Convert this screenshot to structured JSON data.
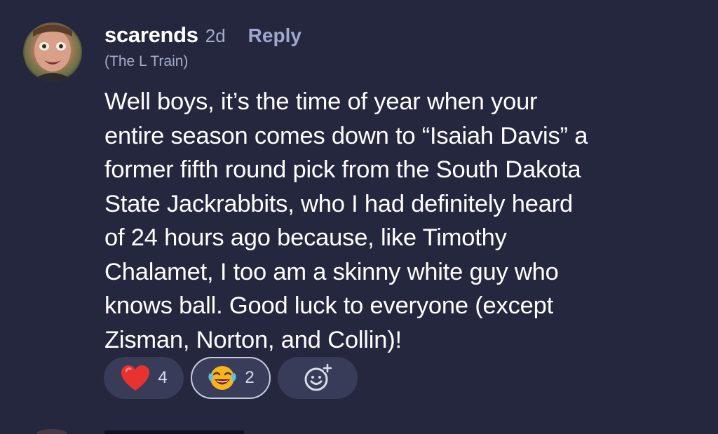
{
  "comment": {
    "username": "scarends",
    "age": "2d",
    "reply_label": "Reply",
    "subtitle": "(The L Train)",
    "body": "Well boys, it’s the time of year when your entire season comes down to “Isaiah Davis” a former fifth round pick from the South Dakota State Jackrabbits, who I had definitely heard of 24 hours ago because, like Timothy Chalamet, I too am a skinny white guy who knows ball. Good luck to everyone (except Zisman, Norton, and Collin)!",
    "body_lines": [
      "Well boys, it’s the time of year when your",
      "entire season comes down to “Isaiah Davis” a",
      "former fifth round pick from the South Dakota",
      "State Jackrabbits, who I had definitely heard",
      "of 24 hours ago because, like Timothy",
      "Chalamet, I too am a skinny white guy who",
      "knows ball. Good luck to everyone (except",
      "Zisman, Norton, and Collin)!"
    ]
  },
  "reactions": [
    {
      "emoji": "red-heart",
      "count": "4",
      "selected": false
    },
    {
      "emoji": "face-with-tears-of-joy",
      "count": "2",
      "selected": true
    },
    {
      "emoji": "add-reaction",
      "count": "",
      "selected": false
    }
  ],
  "colors": {
    "background": "#25273f",
    "chip": "#393c59",
    "muted_text": "#a7adc8",
    "reply": "#9fa7ce",
    "heart": "#e8322f",
    "selected_border": "#c7cbe0"
  }
}
